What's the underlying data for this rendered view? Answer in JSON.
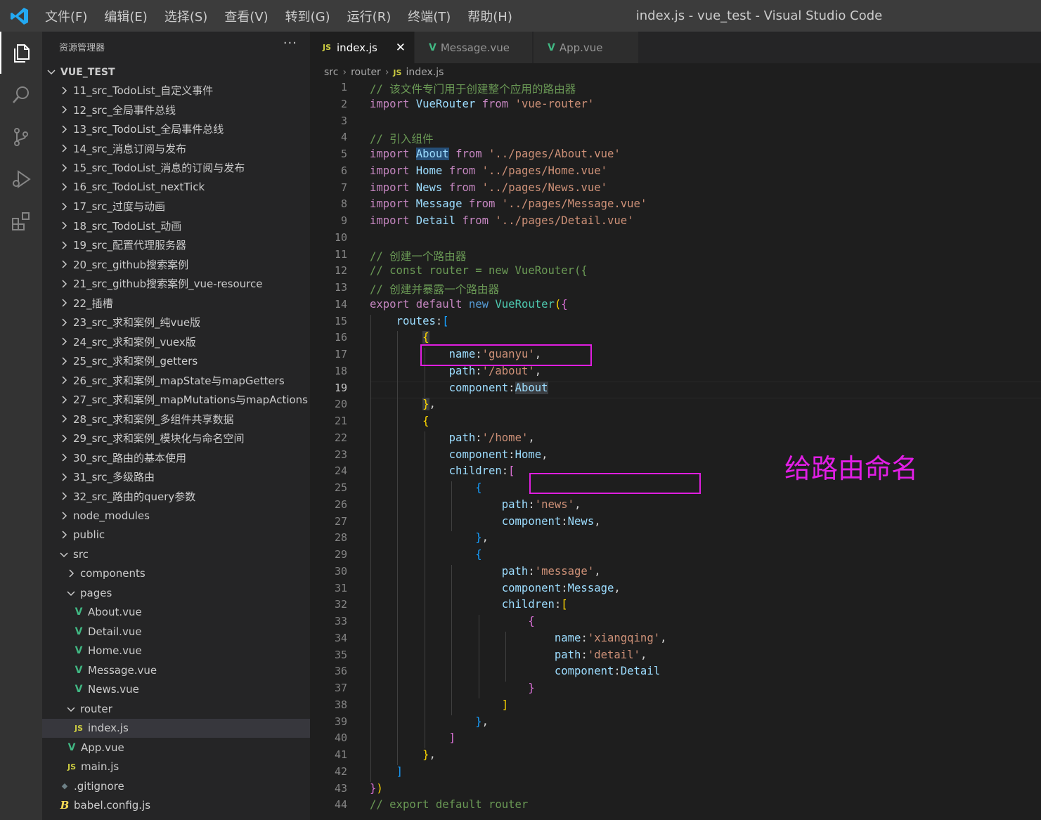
{
  "titlebar": {
    "menu": [
      "文件(F)",
      "编辑(E)",
      "选择(S)",
      "查看(V)",
      "转到(G)",
      "运行(R)",
      "终端(T)",
      "帮助(H)"
    ],
    "window_title": "index.js - vue_test - Visual Studio Code"
  },
  "activity_bar": [
    "files-icon",
    "search-icon",
    "source-control-icon",
    "run-debug-icon",
    "extensions-icon"
  ],
  "sidebar": {
    "header": "资源管理器",
    "more": "···",
    "project": "VUE_TEST",
    "tree": [
      {
        "label": "11_src_TodoList_自定义事件",
        "type": "folder",
        "depth": 1,
        "expanded": false
      },
      {
        "label": "12_src_全局事件总线",
        "type": "folder",
        "depth": 1,
        "expanded": false
      },
      {
        "label": "13_src_TodoList_全局事件总线",
        "type": "folder",
        "depth": 1,
        "expanded": false
      },
      {
        "label": "14_src_消息订阅与发布",
        "type": "folder",
        "depth": 1,
        "expanded": false
      },
      {
        "label": "15_src_TodoList_消息的订阅与发布",
        "type": "folder",
        "depth": 1,
        "expanded": false
      },
      {
        "label": "16_src_TodoList_nextTick",
        "type": "folder",
        "depth": 1,
        "expanded": false
      },
      {
        "label": "17_src_过度与动画",
        "type": "folder",
        "depth": 1,
        "expanded": false
      },
      {
        "label": "18_src_TodoList_动画",
        "type": "folder",
        "depth": 1,
        "expanded": false
      },
      {
        "label": "19_src_配置代理服务器",
        "type": "folder",
        "depth": 1,
        "expanded": false
      },
      {
        "label": "20_src_github搜索案例",
        "type": "folder",
        "depth": 1,
        "expanded": false
      },
      {
        "label": "21_src_github搜索案例_vue-resource",
        "type": "folder",
        "depth": 1,
        "expanded": false
      },
      {
        "label": "22_插槽",
        "type": "folder",
        "depth": 1,
        "expanded": false
      },
      {
        "label": "23_src_求和案例_纯vue版",
        "type": "folder",
        "depth": 1,
        "expanded": false
      },
      {
        "label": "24_src_求和案例_vuex版",
        "type": "folder",
        "depth": 1,
        "expanded": false
      },
      {
        "label": "25_src_求和案例_getters",
        "type": "folder",
        "depth": 1,
        "expanded": false
      },
      {
        "label": "26_src_求和案例_mapState与mapGetters",
        "type": "folder",
        "depth": 1,
        "expanded": false
      },
      {
        "label": "27_src_求和案例_mapMutations与mapActions",
        "type": "folder",
        "depth": 1,
        "expanded": false
      },
      {
        "label": "28_src_求和案例_多组件共享数据",
        "type": "folder",
        "depth": 1,
        "expanded": false
      },
      {
        "label": "29_src_求和案例_模块化与命名空间",
        "type": "folder",
        "depth": 1,
        "expanded": false
      },
      {
        "label": "30_src_路由的基本使用",
        "type": "folder",
        "depth": 1,
        "expanded": false
      },
      {
        "label": "31_src_多级路由",
        "type": "folder",
        "depth": 1,
        "expanded": false
      },
      {
        "label": "32_src_路由的query参数",
        "type": "folder",
        "depth": 1,
        "expanded": false
      },
      {
        "label": "node_modules",
        "type": "folder",
        "depth": 1,
        "expanded": false
      },
      {
        "label": "public",
        "type": "folder",
        "depth": 1,
        "expanded": false
      },
      {
        "label": "src",
        "type": "folder",
        "depth": 1,
        "expanded": true
      },
      {
        "label": "components",
        "type": "folder",
        "depth": 2,
        "expanded": false
      },
      {
        "label": "pages",
        "type": "folder",
        "depth": 2,
        "expanded": true
      },
      {
        "label": "About.vue",
        "type": "vue",
        "depth": 3
      },
      {
        "label": "Detail.vue",
        "type": "vue",
        "depth": 3
      },
      {
        "label": "Home.vue",
        "type": "vue",
        "depth": 3
      },
      {
        "label": "Message.vue",
        "type": "vue",
        "depth": 3
      },
      {
        "label": "News.vue",
        "type": "vue",
        "depth": 3
      },
      {
        "label": "router",
        "type": "folder",
        "depth": 2,
        "expanded": true
      },
      {
        "label": "index.js",
        "type": "js",
        "depth": 3,
        "selected": true
      },
      {
        "label": "App.vue",
        "type": "vue",
        "depth": 2
      },
      {
        "label": "main.js",
        "type": "js",
        "depth": 2
      },
      {
        "label": ".gitignore",
        "type": "git",
        "depth": 1
      },
      {
        "label": "babel.config.js",
        "type": "babel",
        "depth": 1
      }
    ]
  },
  "tabs": [
    {
      "label": "index.js",
      "icon": "JS",
      "active": true,
      "close": "✕"
    },
    {
      "label": "Message.vue",
      "icon": "V",
      "active": false
    },
    {
      "label": "App.vue",
      "icon": "V",
      "active": false
    }
  ],
  "breadcrumb": [
    "src",
    "router",
    "index.js"
  ],
  "breadcrumb_icon": "JS",
  "editor": {
    "current_line": 19,
    "lines": [
      [
        [
          "// 该文件专门用于创建整个应用的路由器",
          "c"
        ]
      ],
      [
        [
          "import",
          "imp"
        ],
        [
          " "
        ],
        [
          "VueRouter",
          "v"
        ],
        [
          " "
        ],
        [
          "from",
          "imp"
        ],
        [
          " "
        ],
        [
          "'vue-router'",
          "s"
        ]
      ],
      [],
      [
        [
          "// 引入组件",
          "c"
        ]
      ],
      [
        [
          "import",
          "imp"
        ],
        [
          " "
        ],
        [
          "About",
          "v hl"
        ],
        [
          " "
        ],
        [
          "from",
          "imp"
        ],
        [
          " "
        ],
        [
          "'../pages/About.vue'",
          "s"
        ]
      ],
      [
        [
          "import",
          "imp"
        ],
        [
          " "
        ],
        [
          "Home",
          "v"
        ],
        [
          " "
        ],
        [
          "from",
          "imp"
        ],
        [
          " "
        ],
        [
          "'../pages/Home.vue'",
          "s"
        ]
      ],
      [
        [
          "import",
          "imp"
        ],
        [
          " "
        ],
        [
          "News",
          "v"
        ],
        [
          " "
        ],
        [
          "from",
          "imp"
        ],
        [
          " "
        ],
        [
          "'../pages/News.vue'",
          "s"
        ]
      ],
      [
        [
          "import",
          "imp"
        ],
        [
          " "
        ],
        [
          "Message",
          "v"
        ],
        [
          " "
        ],
        [
          "from",
          "imp"
        ],
        [
          " "
        ],
        [
          "'../pages/Message.vue'",
          "s"
        ]
      ],
      [
        [
          "import",
          "imp"
        ],
        [
          " "
        ],
        [
          "Detail",
          "v"
        ],
        [
          " "
        ],
        [
          "from",
          "imp"
        ],
        [
          " "
        ],
        [
          "'../pages/Detail.vue'",
          "s"
        ]
      ],
      [],
      [
        [
          "// 创建一个路由器",
          "c"
        ]
      ],
      [
        [
          "// const router = new VueRouter({",
          "c"
        ]
      ],
      [
        [
          "// 创建并暴露一个路由器",
          "c"
        ]
      ],
      [
        [
          "export",
          "imp"
        ],
        [
          " "
        ],
        [
          "default",
          "imp"
        ],
        [
          " "
        ],
        [
          "new",
          "k"
        ],
        [
          " "
        ],
        [
          "VueRouter",
          "f"
        ],
        [
          "(",
          "b1"
        ],
        [
          "{",
          "b2"
        ]
      ],
      [
        [
          "    "
        ],
        [
          "routes",
          "v"
        ],
        [
          ":"
        ],
        [
          "[",
          "b3"
        ]
      ],
      [
        [
          "        "
        ],
        [
          "{",
          "b1 hl2"
        ]
      ],
      [
        [
          "            "
        ],
        [
          "name",
          "v"
        ],
        [
          ":"
        ],
        [
          "'guanyu'",
          "s"
        ],
        [
          ","
        ]
      ],
      [
        [
          "            "
        ],
        [
          "path",
          "v"
        ],
        [
          ":"
        ],
        [
          "'/about'",
          "s"
        ],
        [
          ","
        ]
      ],
      [
        [
          "            "
        ],
        [
          "component",
          "v"
        ],
        [
          ":"
        ],
        [
          "About",
          "v hl2"
        ]
      ],
      [
        [
          "        "
        ],
        [
          "}",
          "b1 hl2"
        ],
        [
          ","
        ]
      ],
      [
        [
          "        "
        ],
        [
          "{",
          "b1"
        ]
      ],
      [
        [
          "            "
        ],
        [
          "path",
          "v"
        ],
        [
          ":"
        ],
        [
          "'/home'",
          "s"
        ],
        [
          ","
        ]
      ],
      [
        [
          "            "
        ],
        [
          "component",
          "v"
        ],
        [
          ":"
        ],
        [
          "Home",
          "v"
        ],
        [
          ","
        ]
      ],
      [
        [
          "            "
        ],
        [
          "children",
          "v"
        ],
        [
          ":"
        ],
        [
          "[",
          "b2"
        ]
      ],
      [
        [
          "                "
        ],
        [
          "{",
          "b3"
        ]
      ],
      [
        [
          "                    "
        ],
        [
          "path",
          "v"
        ],
        [
          ":"
        ],
        [
          "'news'",
          "s"
        ],
        [
          ","
        ]
      ],
      [
        [
          "                    "
        ],
        [
          "component",
          "v"
        ],
        [
          ":"
        ],
        [
          "News",
          "v"
        ],
        [
          ","
        ]
      ],
      [
        [
          "                "
        ],
        [
          "}",
          "b3"
        ],
        [
          ","
        ]
      ],
      [
        [
          "                "
        ],
        [
          "{",
          "b3"
        ]
      ],
      [
        [
          "                    "
        ],
        [
          "path",
          "v"
        ],
        [
          ":"
        ],
        [
          "'message'",
          "s"
        ],
        [
          ","
        ]
      ],
      [
        [
          "                    "
        ],
        [
          "component",
          "v"
        ],
        [
          ":"
        ],
        [
          "Message",
          "v"
        ],
        [
          ","
        ]
      ],
      [
        [
          "                    "
        ],
        [
          "children",
          "v"
        ],
        [
          ":"
        ],
        [
          "[",
          "b1"
        ]
      ],
      [
        [
          "                        "
        ],
        [
          "{",
          "b2"
        ]
      ],
      [
        [
          "                            "
        ],
        [
          "name",
          "v"
        ],
        [
          ":"
        ],
        [
          "'xiangqing'",
          "s"
        ],
        [
          ","
        ]
      ],
      [
        [
          "                            "
        ],
        [
          "path",
          "v"
        ],
        [
          ":"
        ],
        [
          "'detail'",
          "s"
        ],
        [
          ","
        ]
      ],
      [
        [
          "                            "
        ],
        [
          "component",
          "v"
        ],
        [
          ":"
        ],
        [
          "Detail",
          "v"
        ]
      ],
      [
        [
          "                        "
        ],
        [
          "}",
          "b2"
        ]
      ],
      [
        [
          "                    "
        ],
        [
          "]",
          "b1"
        ]
      ],
      [
        [
          "                "
        ],
        [
          "}",
          "b3"
        ],
        [
          ","
        ]
      ],
      [
        [
          "            "
        ],
        [
          "]",
          "b2"
        ]
      ],
      [
        [
          "        "
        ],
        [
          "}",
          "b1"
        ],
        [
          ","
        ]
      ],
      [
        [
          "    "
        ],
        [
          "]",
          "b3"
        ]
      ],
      [
        [
          "}",
          "b2"
        ],
        [
          ")",
          "b1"
        ]
      ],
      [
        [
          "// export default router",
          "c"
        ]
      ]
    ]
  },
  "annotation": "给路由命名",
  "colors": {
    "annotation": "#e21ee6",
    "accent": "#007acc"
  }
}
